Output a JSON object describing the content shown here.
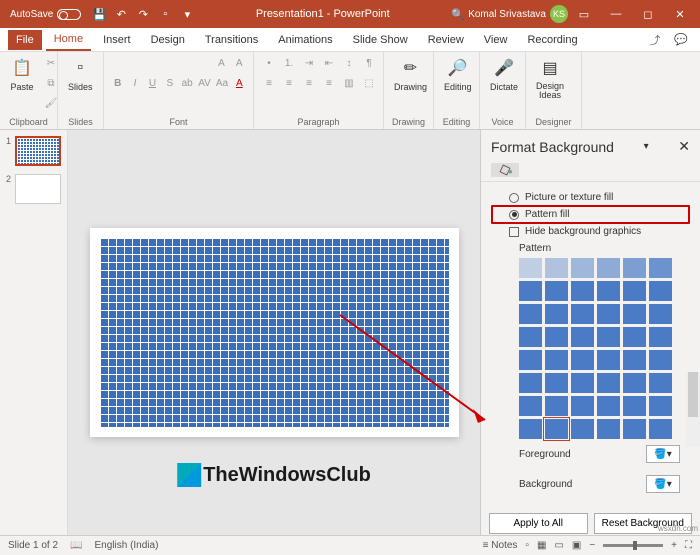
{
  "titlebar": {
    "autosave_label": "AutoSave",
    "autosave_state": "Off",
    "doc": "Presentation1 - PowerPoint",
    "user": "Komal Srivastava",
    "initials": "KS"
  },
  "tabs": {
    "file": "File",
    "items": [
      "Home",
      "Insert",
      "Design",
      "Transitions",
      "Animations",
      "Slide Show",
      "Review",
      "View",
      "Recording"
    ],
    "active": "Home"
  },
  "ribbon": {
    "clipboard": {
      "label": "Clipboard",
      "paste": "Paste"
    },
    "slides": {
      "label": "Slides",
      "btn": "Slides"
    },
    "font": {
      "label": "Font"
    },
    "paragraph": {
      "label": "Paragraph"
    },
    "drawing": {
      "label": "Drawing",
      "btn": "Drawing"
    },
    "editing": {
      "label": "Editing",
      "btn": "Editing"
    },
    "voice": {
      "label": "Voice",
      "btn": "Dictate"
    },
    "designer": {
      "label": "Designer",
      "btn": "Design\nIdeas"
    }
  },
  "thumbs": [
    {
      "n": "1"
    },
    {
      "n": "2"
    }
  ],
  "pane": {
    "title": "Format Background",
    "opt_picture": "Picture or texture fill",
    "opt_pattern": "Pattern fill",
    "opt_hide": "Hide background graphics",
    "pattern_label": "Pattern",
    "foreground": "Foreground",
    "background": "Background",
    "apply": "Apply to All",
    "reset": "Reset Background"
  },
  "status": {
    "slide": "Slide 1 of 2",
    "lang": "English (India)",
    "notes": "Notes",
    "zoom": "+"
  },
  "watermark": {
    "text": "TheWindowsClub",
    "corner": "wsxdn.com"
  }
}
